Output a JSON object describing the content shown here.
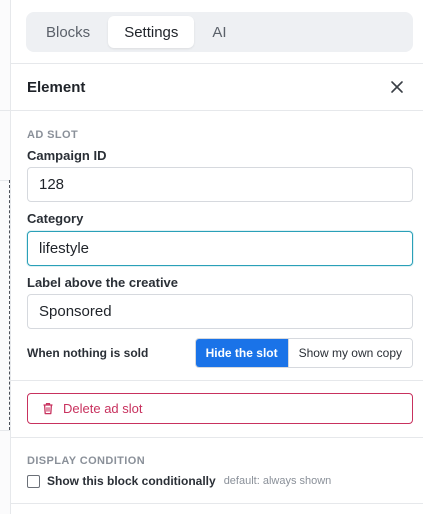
{
  "tabs": [
    {
      "label": "Blocks",
      "active": false
    },
    {
      "label": "Settings",
      "active": true
    },
    {
      "label": "AI",
      "active": false
    }
  ],
  "panel": {
    "title": "Element",
    "close_icon": "close-icon"
  },
  "ad_slot": {
    "section_label": "AD SLOT",
    "campaign_id": {
      "label": "Campaign ID",
      "value": "128"
    },
    "category": {
      "label": "Category",
      "value": "lifestyle"
    },
    "label_above": {
      "label": "Label above the creative",
      "value": "Sponsored"
    },
    "when_nothing_sold": {
      "label": "When nothing is sold",
      "options": [
        "Hide the slot",
        "Show my own copy"
      ],
      "selected": "Hide the slot"
    }
  },
  "delete": {
    "label": "Delete ad slot",
    "icon": "trash-icon"
  },
  "display_condition": {
    "section_label": "DISPLAY CONDITION",
    "checkbox_label": "Show this block conditionally",
    "hint": "default: always shown",
    "checked": false
  },
  "colors": {
    "accent": "#1a73e8",
    "focus": "#2aa0b8",
    "danger": "#c8315e"
  }
}
